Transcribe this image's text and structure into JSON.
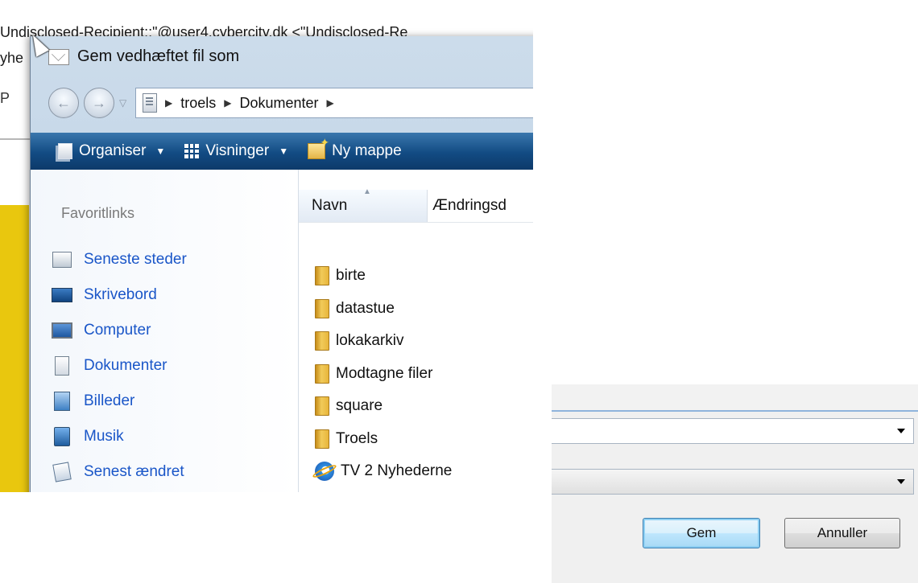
{
  "background": {
    "header_line1": "Undisclosed-Recipient:;\"@user4.cybercity.dk <\"Undisclosed-Re",
    "header_line2": "yhe",
    "strip_letter": "P"
  },
  "dialog": {
    "title": "Gem vedhæftet fil som",
    "address_parts": [
      "troels",
      "Dokumenter"
    ],
    "toolbar": {
      "organise": "Organiser",
      "views": "Visninger",
      "new_folder": "Ny mappe"
    },
    "favorites": {
      "header": "Favoritlinks",
      "items": [
        {
          "label": "Seneste steder",
          "icon": "recent-places-icon"
        },
        {
          "label": "Skrivebord",
          "icon": "desktop-icon"
        },
        {
          "label": "Computer",
          "icon": "computer-icon"
        },
        {
          "label": "Dokumenter",
          "icon": "documents-icon"
        },
        {
          "label": "Billeder",
          "icon": "pictures-icon"
        },
        {
          "label": "Musik",
          "icon": "music-icon"
        },
        {
          "label": "Senest ændret",
          "icon": "recently-changed-icon"
        }
      ]
    },
    "columns": {
      "name": "Navn",
      "date": "Ændringsd"
    },
    "files": [
      {
        "name": "birte",
        "type": "folder"
      },
      {
        "name": "datastue",
        "type": "folder"
      },
      {
        "name": "lokakarkiv",
        "type": "folder"
      },
      {
        "name": "Modtagne filer",
        "type": "folder"
      },
      {
        "name": "square",
        "type": "folder"
      },
      {
        "name": "Troels",
        "type": "folder"
      },
      {
        "name": "TV 2 Nyhederne",
        "type": "internet-shortcut"
      }
    ]
  },
  "footer": {
    "filename_value": "",
    "filetype_value": "",
    "save_label": "Gem",
    "cancel_label": "Annuller"
  },
  "colors": {
    "toolbar_blue": "#124b83",
    "link_blue": "#1a56c8",
    "folder_gold": "#e8b53b"
  }
}
